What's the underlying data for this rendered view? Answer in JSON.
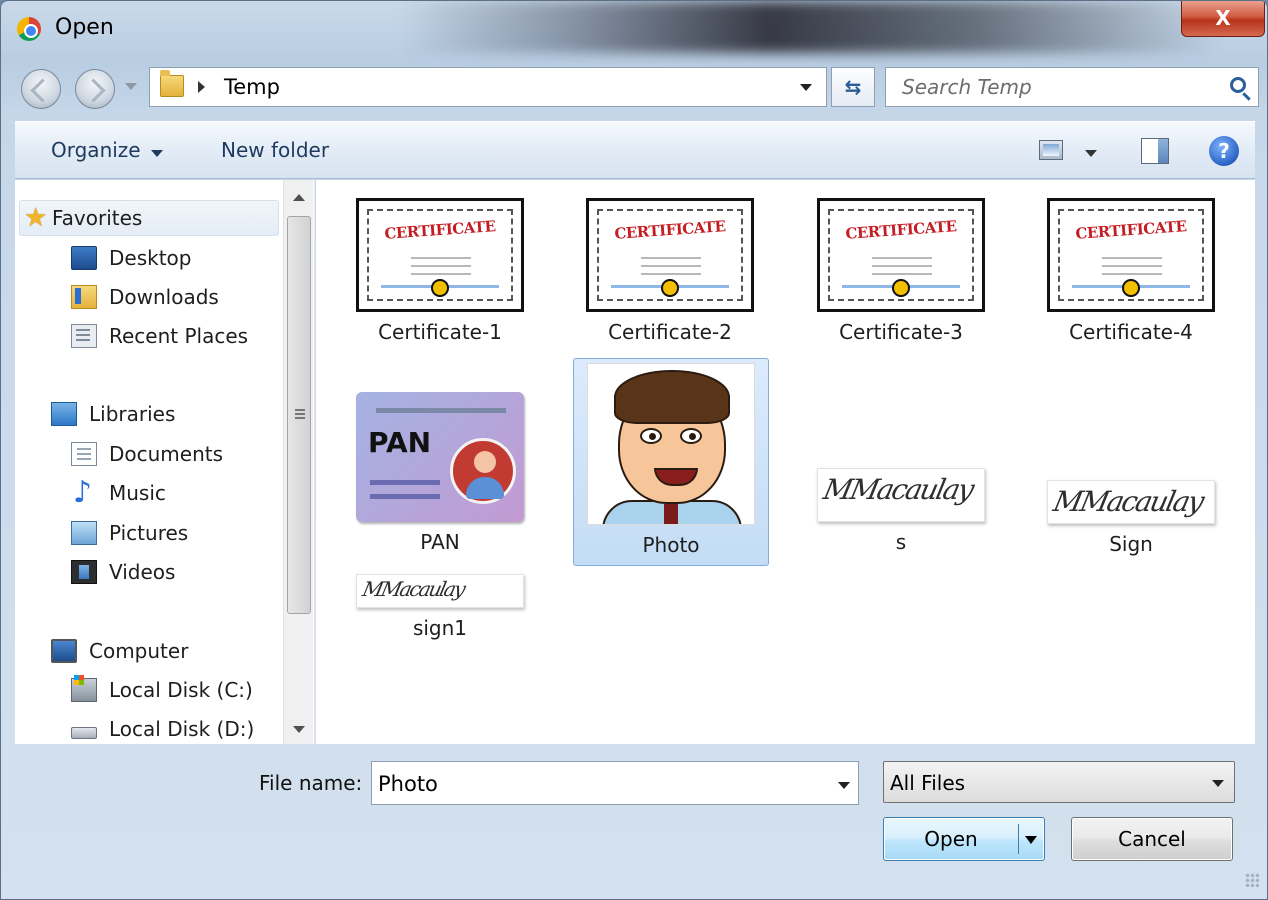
{
  "window": {
    "title": "Open",
    "close_label": "X"
  },
  "address": {
    "path": "Temp",
    "refresh_glyph": "⇆"
  },
  "search": {
    "placeholder": "Search Temp"
  },
  "toolbar": {
    "organize_label": "Organize",
    "new_folder_label": "New folder",
    "help_glyph": "?"
  },
  "navigation": {
    "favorites": {
      "label": "Favorites",
      "items": [
        "Desktop",
        "Downloads",
        "Recent Places"
      ]
    },
    "libraries": {
      "label": "Libraries",
      "items": [
        "Documents",
        "Music",
        "Pictures",
        "Videos"
      ]
    },
    "computer": {
      "label": "Computer",
      "items": [
        "Local Disk (C:)",
        "Local Disk (D:)"
      ]
    }
  },
  "files": [
    {
      "name": "Certificate-1",
      "thumb_text": "CERTIFICATE"
    },
    {
      "name": "Certificate-2",
      "thumb_text": "CERTIFICATE"
    },
    {
      "name": "Certificate-3",
      "thumb_text": "CERTIFICATE"
    },
    {
      "name": "Certificate-4",
      "thumb_text": "CERTIFICATE"
    },
    {
      "name": "PAN",
      "thumb_text": "PAN"
    },
    {
      "name": "Photo",
      "selected": true
    },
    {
      "name": "s",
      "thumb_text": "MMacaulay"
    },
    {
      "name": "Sign",
      "thumb_text": "MMacaulay"
    },
    {
      "name": "sign1",
      "thumb_text": "MMacaulay"
    }
  ],
  "bottom": {
    "file_name_label": "File name:",
    "file_name_value": "Photo",
    "file_type_value": "All Files",
    "open_label": "Open",
    "cancel_label": "Cancel"
  }
}
